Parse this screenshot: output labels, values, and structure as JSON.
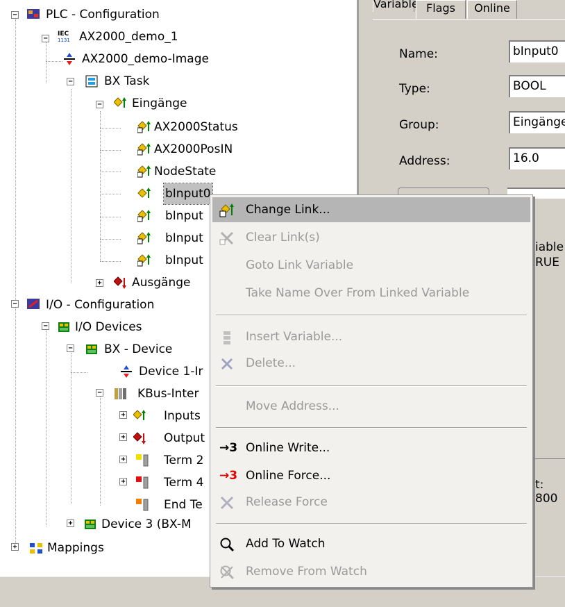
{
  "tree": {
    "items": [
      {
        "label": "PLC - Configuration",
        "icon": "plc-config-icon"
      },
      {
        "label": "AX2000_demo_1",
        "icon": "iec-1131-icon"
      },
      {
        "label": "AX2000_demo-Image",
        "icon": "image-arrow-icon"
      },
      {
        "label": "BX Task",
        "icon": "task-icon"
      },
      {
        "label": "Eingänge",
        "icon": "inputs-folder-icon"
      },
      {
        "label": "AX2000Status",
        "icon": "linked-input-var-icon"
      },
      {
        "label": "AX2000PosIN",
        "icon": "linked-input-var-icon"
      },
      {
        "label": "NodeState",
        "icon": "linked-input-var-icon"
      },
      {
        "label": "bInput0",
        "icon": "input-var-icon"
      },
      {
        "label": "bInput",
        "icon": "linked-input-var-icon"
      },
      {
        "label": "bInput",
        "icon": "linked-input-var-icon"
      },
      {
        "label": "bInput",
        "icon": "linked-input-var-icon"
      },
      {
        "label": "Ausgänge",
        "icon": "outputs-folder-icon"
      },
      {
        "label": "I/O - Configuration",
        "icon": "io-config-icon"
      },
      {
        "label": "I/O Devices",
        "icon": "io-devices-icon"
      },
      {
        "label": "BX - Device",
        "icon": "bx-device-icon"
      },
      {
        "label": "Device 1-Ir",
        "icon": "image-arrow-icon"
      },
      {
        "label": "KBus-Inter",
        "icon": "kbus-icon"
      },
      {
        "label": "Inputs",
        "icon": "inputs-folder-icon"
      },
      {
        "label": "Output",
        "icon": "outputs-folder-icon"
      },
      {
        "label": "Term 2",
        "icon": "terminal-yellow-icon"
      },
      {
        "label": "Term 4",
        "icon": "terminal-red-icon"
      },
      {
        "label": "End Te",
        "icon": "end-terminal-icon"
      },
      {
        "label": "Device 3 (BX-M",
        "icon": "bx-device-icon"
      },
      {
        "label": "Mappings",
        "icon": "mappings-icon"
      }
    ]
  },
  "panel": {
    "tabs": [
      "Variable",
      "Flags",
      "Online"
    ],
    "name_label": "Name:",
    "name_value": "bInput0",
    "type_label": "Type:",
    "type_value": "BOOL",
    "group_label": "Group:",
    "group_value": "Eingänge",
    "address_label": "Address:",
    "address_value": "16.0",
    "partial_1": "iable",
    "partial_2": "RUE",
    "partial_3": "t: 800"
  },
  "menu": {
    "change_link": "Change Link...",
    "clear_link": "Clear Link(s)",
    "goto_link": "Goto Link Variable",
    "take_name": "Take Name Over From Linked Variable",
    "insert_var": "Insert Variable...",
    "delete": "Delete...",
    "move_addr": "Move Address...",
    "online_write": "Online Write...",
    "online_force": "Online Force...",
    "release_force": "Release Force",
    "add_watch": "Add To Watch",
    "remove_watch": "Remove From Watch"
  },
  "colors": {
    "menu_highlight": "#b5b5b5",
    "disabled": "#9a9a9a",
    "force_red": "#e00000"
  }
}
